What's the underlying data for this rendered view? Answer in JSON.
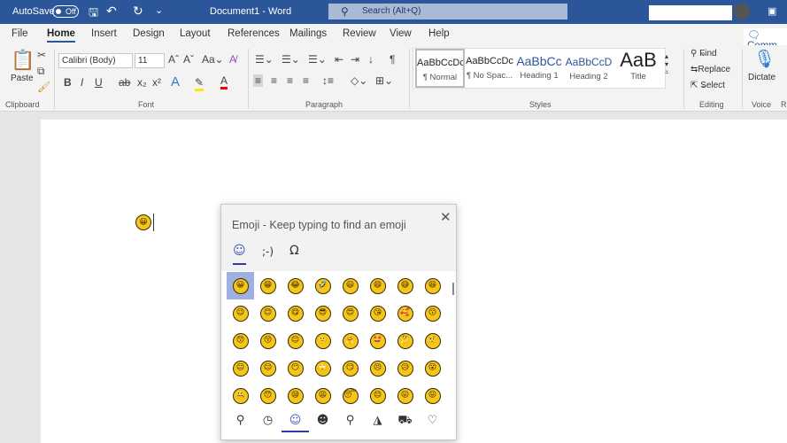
{
  "titlebar": {
    "autosave": "AutoSave",
    "toggle": "Off",
    "doc_title": "Document1  -  Word",
    "search_placeholder": "Search (Alt+Q)"
  },
  "tabs": [
    "File",
    "Home",
    "Insert",
    "Design",
    "Layout",
    "References",
    "Mailings",
    "Review",
    "View",
    "Help"
  ],
  "comments": "Comm",
  "ribbon": {
    "paste": "Paste",
    "font_name": "Calibri (Body)",
    "font_size": "11",
    "styles": [
      {
        "preview": "AaBbCcDc",
        "label": "¶ Normal"
      },
      {
        "preview": "AaBbCcDc",
        "label": "¶ No Spac..."
      },
      {
        "preview": "AaBbCc",
        "label": "Heading 1"
      },
      {
        "preview": "AaBbCcD",
        "label": "Heading 2"
      },
      {
        "preview": "AaB",
        "label": "Title"
      }
    ],
    "find": "Find",
    "replace": "Replace",
    "select": "Select",
    "dictate": "Dictate",
    "groups": {
      "clipboard": "Clipboard",
      "font": "Font",
      "paragraph": "Paragraph",
      "styles": "Styles",
      "editing": "Editing",
      "voice": "Voice",
      "r": "R"
    }
  },
  "document": {
    "inserted_emoji": "😀"
  },
  "emoji_panel": {
    "title": "Emoji - Keep typing to find an emoji",
    "tabs": [
      "☺",
      ";-)",
      "Ω"
    ],
    "active_tab": 0,
    "emojis": [
      "😀",
      "😁",
      "😂",
      "🤣",
      "😃",
      "😄",
      "😅",
      "😆",
      "😉",
      "😊",
      "😋",
      "😎",
      "😍",
      "😘",
      "🥰",
      "😗",
      "😙",
      "😚",
      "☺",
      "🙂",
      "🤗",
      "🤩",
      "🤔",
      "🤨",
      "😐",
      "😑",
      "😶",
      "🙄",
      "😏",
      "😣",
      "😥",
      "😮",
      "🤐",
      "😯",
      "😪",
      "😫",
      "😴",
      "😌",
      "😛",
      "😜"
    ],
    "selected_index": 0,
    "nav": [
      "⚲",
      "◷",
      "☺",
      "☻",
      "⚲",
      "◮",
      "⛟",
      "♡"
    ],
    "nav_active": 2
  },
  "colors": {
    "title_bar": "#2b579a",
    "accent": "#2b579a",
    "selection": "#9fb0e0"
  }
}
